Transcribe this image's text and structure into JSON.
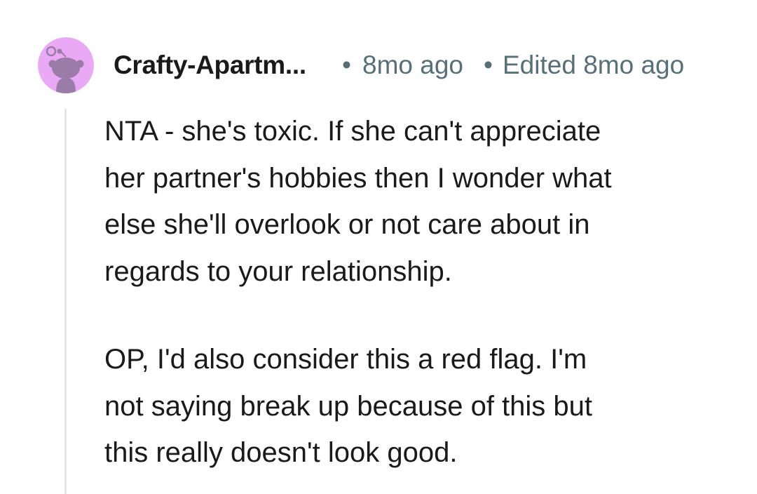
{
  "comment": {
    "author": "Crafty-Apartm...",
    "separator": "•",
    "timestamp": "8mo ago",
    "edited": "Edited 8mo ago",
    "paragraphs": [
      "NTA - she's toxic. If she can't appreciate\nher partner's hobbies then I wonder what\nelse she'll overlook or not care about in\nregards to your relationship.",
      "OP, I'd also consider this a red flag. I'm\nnot saying break up because of this but\nthis really doesn't look good."
    ]
  },
  "colors": {
    "avatar_background": "#e9a9f5",
    "avatar_figure": "#9b7ba8",
    "text_primary": "#1a1a1b",
    "text_meta": "#576f76",
    "thread_line": "#e5e5e5"
  },
  "icons": {
    "avatar": "snoo-avatar-icon"
  }
}
